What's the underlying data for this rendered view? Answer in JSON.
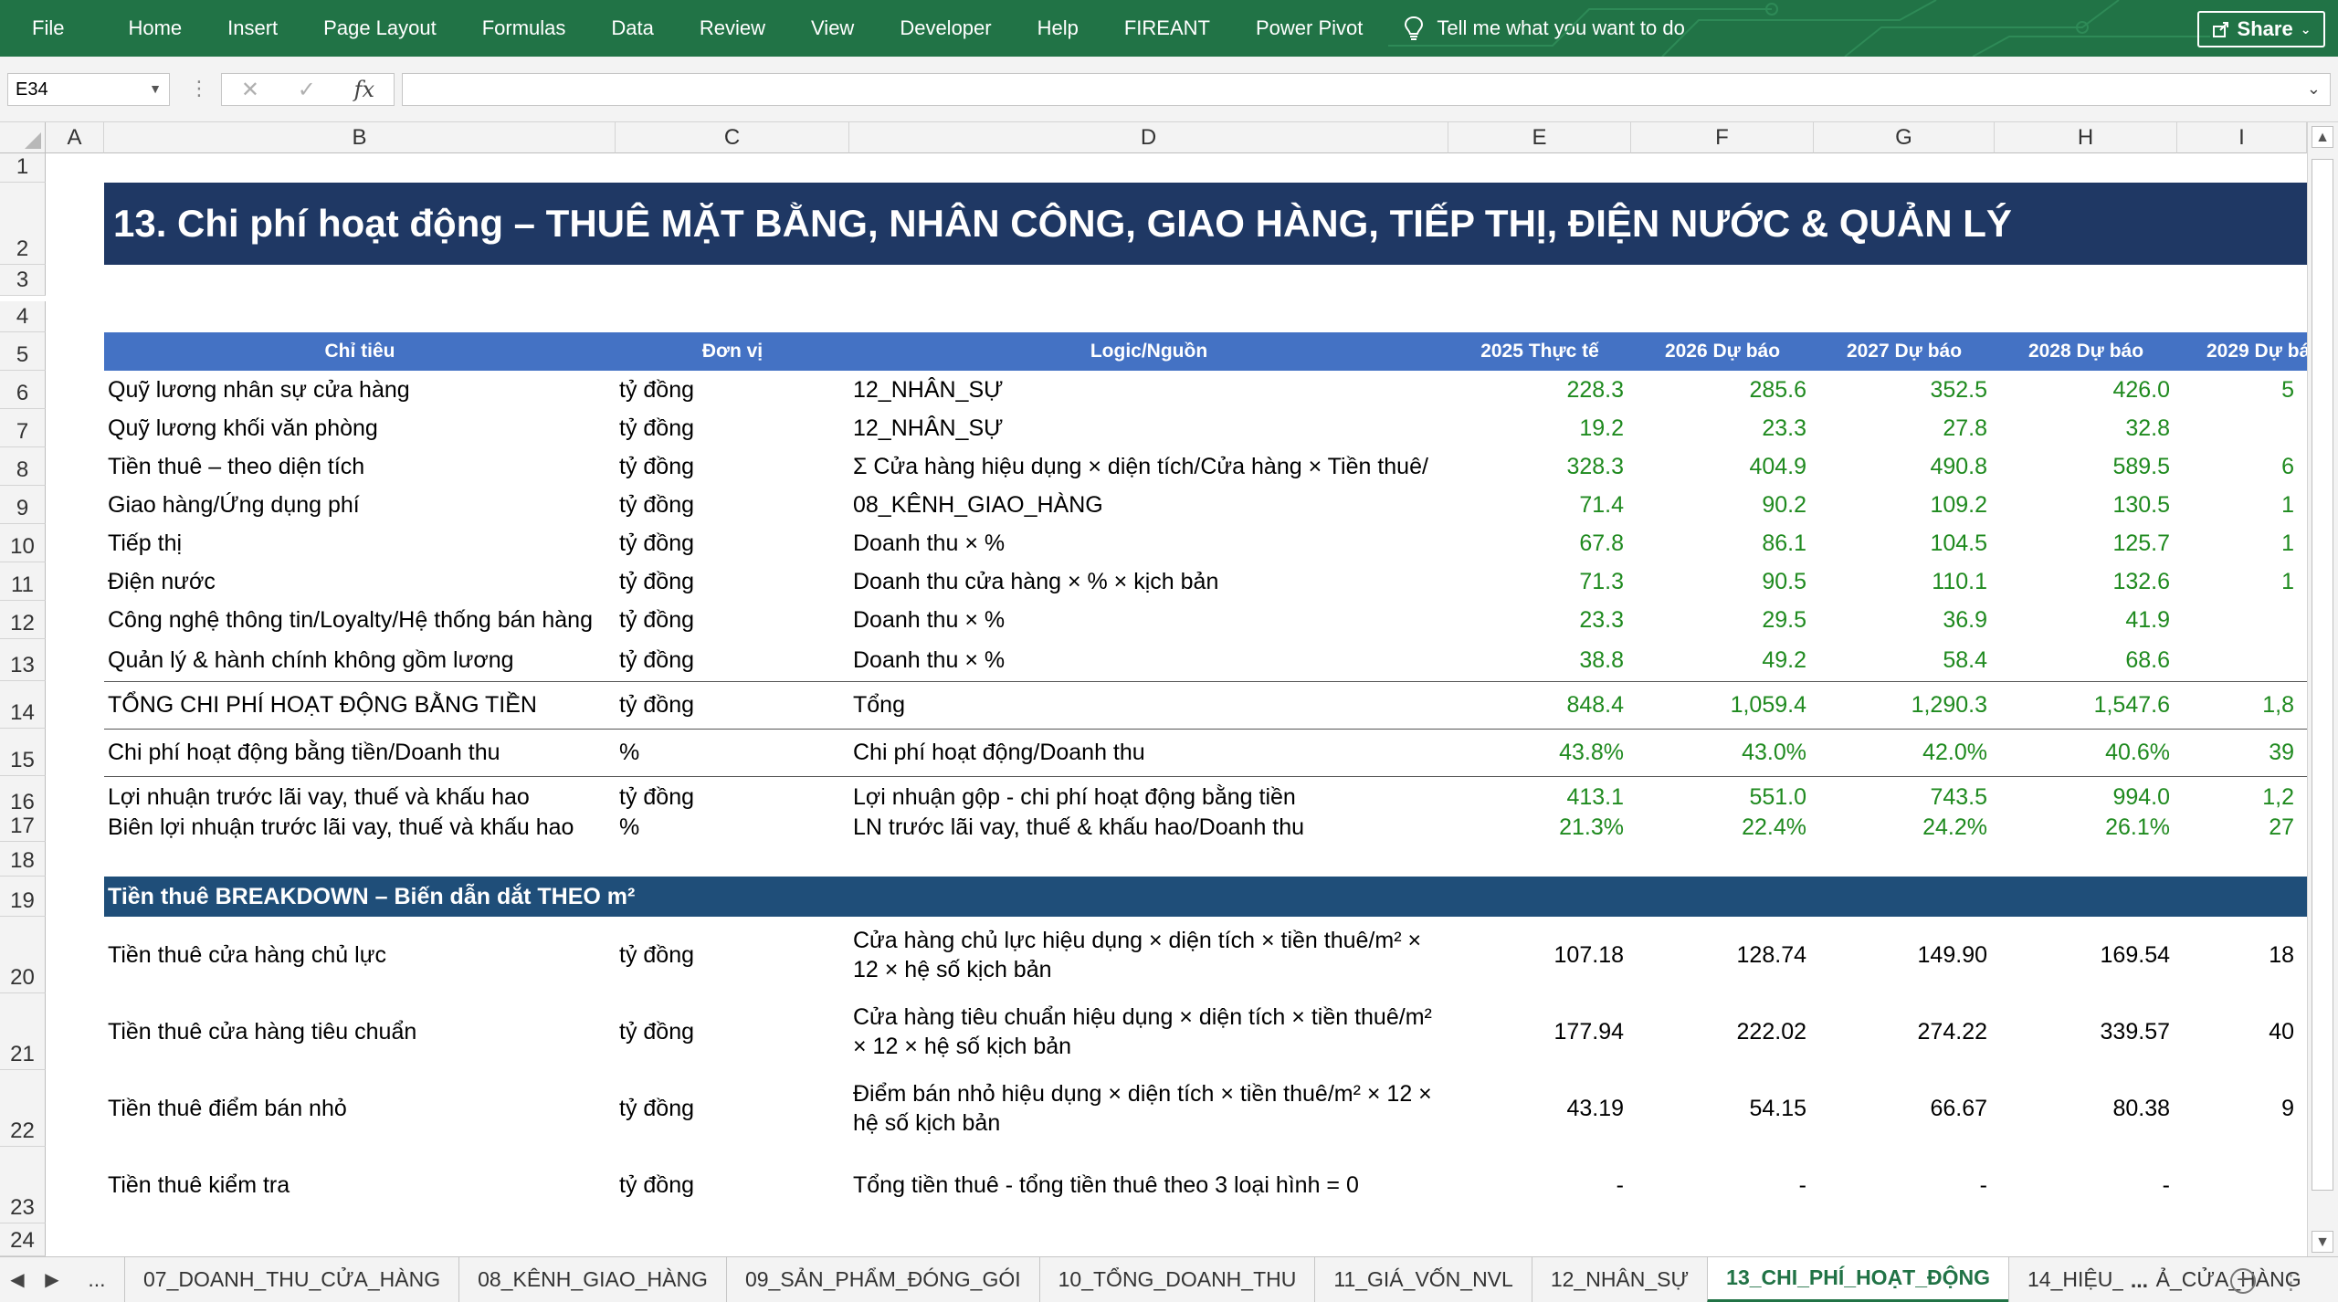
{
  "ribbon": {
    "tabs": [
      "File",
      "Home",
      "Insert",
      "Page Layout",
      "Formulas",
      "Data",
      "Review",
      "View",
      "Developer",
      "Help",
      "FIREANT",
      "Power Pivot"
    ],
    "tell_me": "Tell me what you want to do",
    "share": "Share",
    "color": "#217346"
  },
  "formula_bar": {
    "name_box": "E34",
    "formula": ""
  },
  "columns": [
    "A",
    "B",
    "C",
    "D",
    "E",
    "F",
    "G",
    "H",
    "I"
  ],
  "rows": [
    "1",
    "2",
    "3",
    "4",
    "5",
    "6",
    "7",
    "8",
    "9",
    "10",
    "11",
    "12",
    "13",
    "14",
    "15",
    "16",
    "17",
    "18",
    "19",
    "20",
    "21",
    "22",
    "23",
    "24"
  ],
  "sheet": {
    "title": "13. Chi phí hoạt động – THUÊ MẶT BẰNG, NHÂN CÔNG, GIAO HÀNG, TIẾP THỊ, ĐIỆN NƯỚC & QUẢN LÝ",
    "headers": [
      "Chỉ tiêu",
      "Đơn vị",
      "Logic/Nguồn",
      "2025 Thực tế",
      "2026 Dự báo",
      "2027 Dự báo",
      "2028 Dự báo",
      "2029 Dự bá"
    ],
    "table": [
      {
        "label": "Quỹ lương nhân sự cửa hàng",
        "unit": "tỷ đồng",
        "logic": "12_NHÂN_SỰ",
        "v": [
          "228.3",
          "285.6",
          "352.5",
          "426.0",
          "5"
        ]
      },
      {
        "label": "Quỹ lương khối văn phòng",
        "unit": "tỷ đồng",
        "logic": "12_NHÂN_SỰ",
        "v": [
          "19.2",
          "23.3",
          "27.8",
          "32.8",
          ""
        ]
      },
      {
        "label": "Tiền thuê – theo diện tích",
        "unit": "tỷ đồng",
        "logic": "Σ Cửa hàng hiệu dụng × diện tích/Cửa hàng × Tiền thuê/",
        "v": [
          "328.3",
          "404.9",
          "490.8",
          "589.5",
          "6"
        ]
      },
      {
        "label": "Giao hàng/Ứng dụng phí",
        "unit": "tỷ đồng",
        "logic": "08_KÊNH_GIAO_HÀNG",
        "v": [
          "71.4",
          "90.2",
          "109.2",
          "130.5",
          "1"
        ]
      },
      {
        "label": "Tiếp thị",
        "unit": "tỷ đồng",
        "logic": "Doanh thu × %",
        "v": [
          "67.8",
          "86.1",
          "104.5",
          "125.7",
          "1"
        ]
      },
      {
        "label": "Điện nước",
        "unit": "tỷ đồng",
        "logic": "Doanh thu cửa hàng × % × kịch bản",
        "v": [
          "71.3",
          "90.5",
          "110.1",
          "132.6",
          "1"
        ]
      },
      {
        "label": "Công nghệ thông tin/Loyalty/Hệ thống bán hàng",
        "unit": "tỷ đồng",
        "logic": "Doanh thu × %",
        "v": [
          "23.3",
          "29.5",
          "36.9",
          "41.9",
          ""
        ]
      },
      {
        "label": "Quản lý & hành chính không gồm lương",
        "unit": "tỷ đồng",
        "logic": "Doanh thu × %",
        "v": [
          "38.8",
          "49.2",
          "58.4",
          "68.6",
          ""
        ]
      },
      {
        "label": "TỔNG CHI PHÍ HOẠT ĐỘNG BẰNG TIỀN",
        "unit": "tỷ đồng",
        "logic": "Tổng",
        "v": [
          "848.4",
          "1,059.4",
          "1,290.3",
          "1,547.6",
          "1,8"
        ]
      },
      {
        "label": "Chi phí hoạt động bằng tiền/Doanh thu",
        "unit": "%",
        "logic": "Chi phí hoạt động/Doanh thu",
        "v": [
          "43.8%",
          "43.0%",
          "42.0%",
          "40.6%",
          "39"
        ]
      },
      {
        "label": "Lợi nhuận trước lãi vay, thuế và khấu hao",
        "unit": "tỷ đồng",
        "logic": "Lợi nhuận gộp - chi phí hoạt động bằng tiền",
        "v": [
          "413.1",
          "551.0",
          "743.5",
          "994.0",
          "1,2"
        ]
      },
      {
        "label": "Biên lợi nhuận trước lãi vay, thuế và khấu hao",
        "unit": "%",
        "logic": "LN trước lãi vay, thuế & khấu hao/Doanh thu",
        "v": [
          "21.3%",
          "22.4%",
          "24.2%",
          "26.1%",
          "27"
        ]
      }
    ],
    "section2_title": "Tiền thuê BREAKDOWN – Biến dẫn dắt THEO m²",
    "rent": [
      {
        "label": "Tiền thuê cửa hàng chủ lực",
        "unit": "tỷ đồng",
        "logic": "Cửa hàng chủ lực hiệu dụng × diện tích × tiền thuê/m² × 12 × hệ số kịch bản",
        "v": [
          "107.18",
          "128.74",
          "149.90",
          "169.54",
          "18"
        ]
      },
      {
        "label": "Tiền thuê cửa hàng tiêu chuẩn",
        "unit": "tỷ đồng",
        "logic": "Cửa hàng tiêu chuẩn hiệu dụng × diện tích × tiền thuê/m² × 12 × hệ số kịch bản",
        "v": [
          "177.94",
          "222.02",
          "274.22",
          "339.57",
          "40"
        ]
      },
      {
        "label": "Tiền thuê điểm bán nhỏ",
        "unit": "tỷ đồng",
        "logic": "Điểm bán nhỏ hiệu dụng × diện tích × tiền thuê/m² × 12 × hệ số kịch bản",
        "v": [
          "43.19",
          "54.15",
          "66.67",
          "80.38",
          "9"
        ]
      },
      {
        "label": "Tiền thuê kiểm tra",
        "unit": "tỷ đồng",
        "logic": "Tổng tiền thuê - tổng tiền thuê theo 3 loại hình = 0",
        "v": [
          "-",
          "-",
          "-",
          "-",
          ""
        ]
      }
    ]
  },
  "sheet_tabs": {
    "ellipsis": "...",
    "tabs": [
      "07_DOANH_THU_CỬA_HÀNG",
      "08_KÊNH_GIAO_HÀNG",
      "09_SẢN_PHẨM_ĐÓNG_GÓI",
      "10_TỔNG_DOANH_THU",
      "11_GIÁ_VỐN_NVL",
      "12_NHÂN_SỰ",
      "13_CHI_PHÍ_HOẠT_ĐỘNG",
      "14_HIỆU_QUẢ_CỬA_HÀNG"
    ],
    "active": "13_CHI_PHÍ_HOẠT_ĐỘNG",
    "more": "..."
  }
}
